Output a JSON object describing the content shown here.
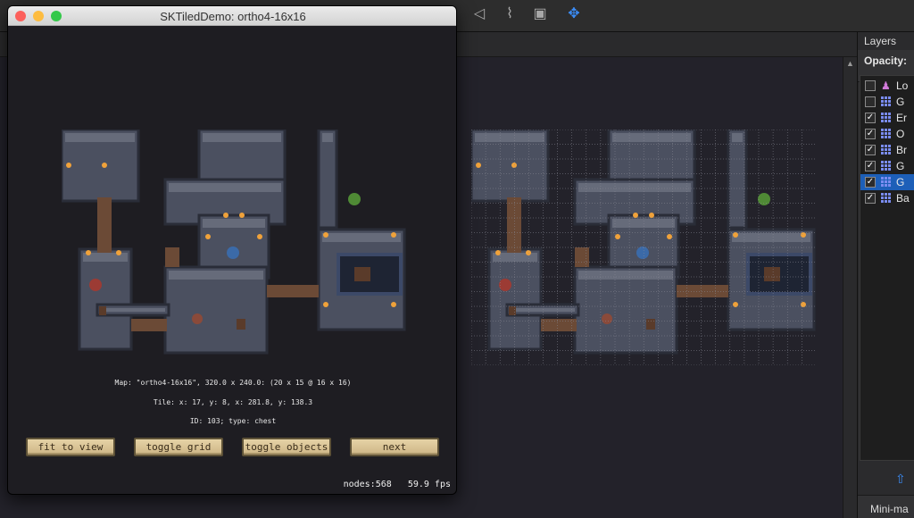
{
  "window": {
    "title": "SKTiledDemo: ortho4-16x16",
    "traffic_colors": [
      "#fc605b",
      "#fdbc40",
      "#34c84a"
    ]
  },
  "demo": {
    "map_info": "Map: \"ortho4-16x16\", 320.0 x 240.0: (20 x 15 @ 16 x 16)",
    "tile_info": "Tile: x: 17, y: 8, x: 281.8, y: 138.3",
    "object_info": "ID: 103; type: chest",
    "buttons": {
      "fit": "fit to view",
      "grid": "toggle grid",
      "objects": "toggle objects",
      "next": "next"
    },
    "stats": {
      "nodes": "nodes:568",
      "fps": "59.9 fps"
    }
  },
  "toolbar": {
    "icons": [
      "polygon-tool-icon",
      "polyline-tool-icon",
      "image-tool-icon",
      "move-tool-icon"
    ]
  },
  "layers_panel": {
    "title": "Layers",
    "opacity_label": "Opacity:",
    "layers": [
      {
        "name": "Lo",
        "checked": false,
        "icon": "group",
        "selected": false
      },
      {
        "name": "G",
        "checked": false,
        "icon": "grid",
        "selected": false
      },
      {
        "name": "Er",
        "checked": true,
        "icon": "grid",
        "selected": false
      },
      {
        "name": "O",
        "checked": true,
        "icon": "grid",
        "selected": false
      },
      {
        "name": "Br",
        "checked": true,
        "icon": "grid",
        "selected": false
      },
      {
        "name": "G",
        "checked": true,
        "icon": "grid",
        "selected": false
      },
      {
        "name": "G",
        "checked": true,
        "icon": "grid",
        "selected": true
      },
      {
        "name": "Ba",
        "checked": true,
        "icon": "grid",
        "selected": false
      }
    ],
    "minimap_label": "Mini-ma",
    "accent": "#1d5fb8"
  }
}
